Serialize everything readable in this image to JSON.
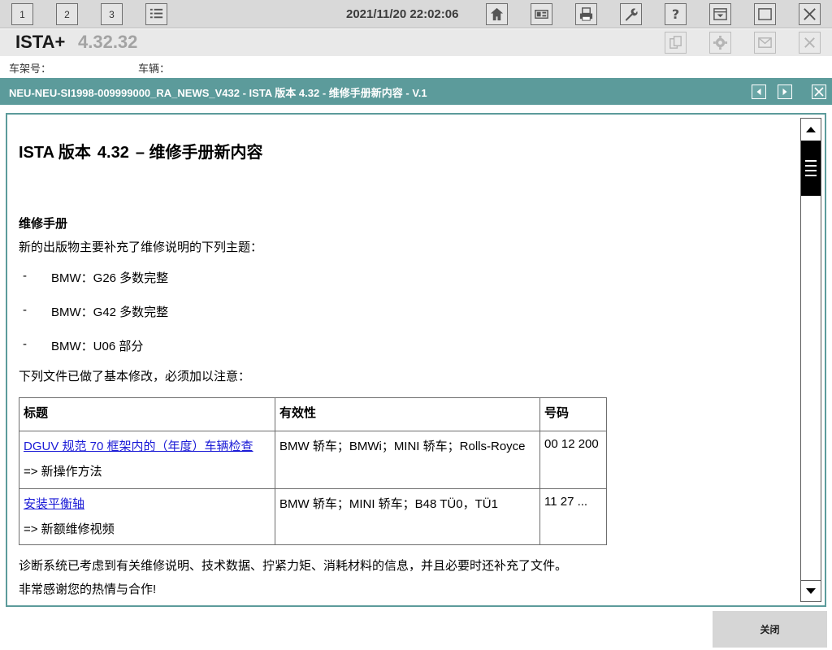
{
  "toolbar": {
    "tabs": [
      "1",
      "2",
      "3"
    ],
    "datetime": "2021/11/20 22:02:06"
  },
  "app": {
    "name": "ISTA+",
    "version": "4.32.32"
  },
  "vehicle_info": {
    "vin_label": "车架号：",
    "vehicle_label": "车辆："
  },
  "document": {
    "header": "NEU-NEU-SI1998-009999000_RA_NEWS_V432 - ISTA 版本 4.32 - 维修手册新内容 - V.1",
    "title_a": "ISTA 版本",
    "title_num": "4.32",
    "title_b": "–  维修手册新内容",
    "section": "维修手册",
    "intro": "新的出版物主要补充了维修说明的下列主题：",
    "list": [
      {
        "dash": "-",
        "text": "BMW：G26 多数完整"
      },
      {
        "dash": "-",
        "text": "BMW：G42 多数完整"
      },
      {
        "dash": "-",
        "text": "BMW：U06 部分"
      }
    ],
    "note": "下列文件已做了基本修改，必须加以注意：",
    "table": {
      "headers": [
        "标题",
        "有效性",
        "号码"
      ],
      "rows": [
        {
          "title": "DGUV 规范 70 框架内的（年度）车辆检查",
          "sub": "=> 新操作方法",
          "validity": "BMW 轿车；BMWi；MINI 轿车；Rolls-Royce",
          "number": "00 12 200"
        },
        {
          "title": "安装平衡轴",
          "sub": "=> 新额维修视频",
          "validity": "BMW 轿车；MINI 轿车；B48 TÜ0，TÜ1",
          "number": "11 27 ..."
        }
      ]
    },
    "footer1": "诊断系统已考虑到有关维修说明、技术数据、拧紧力矩、消耗材料的信息，并且必要时还补充了文件。",
    "footer2": "非常感谢您的热情与合作!"
  },
  "buttons": {
    "close": "关闭"
  }
}
